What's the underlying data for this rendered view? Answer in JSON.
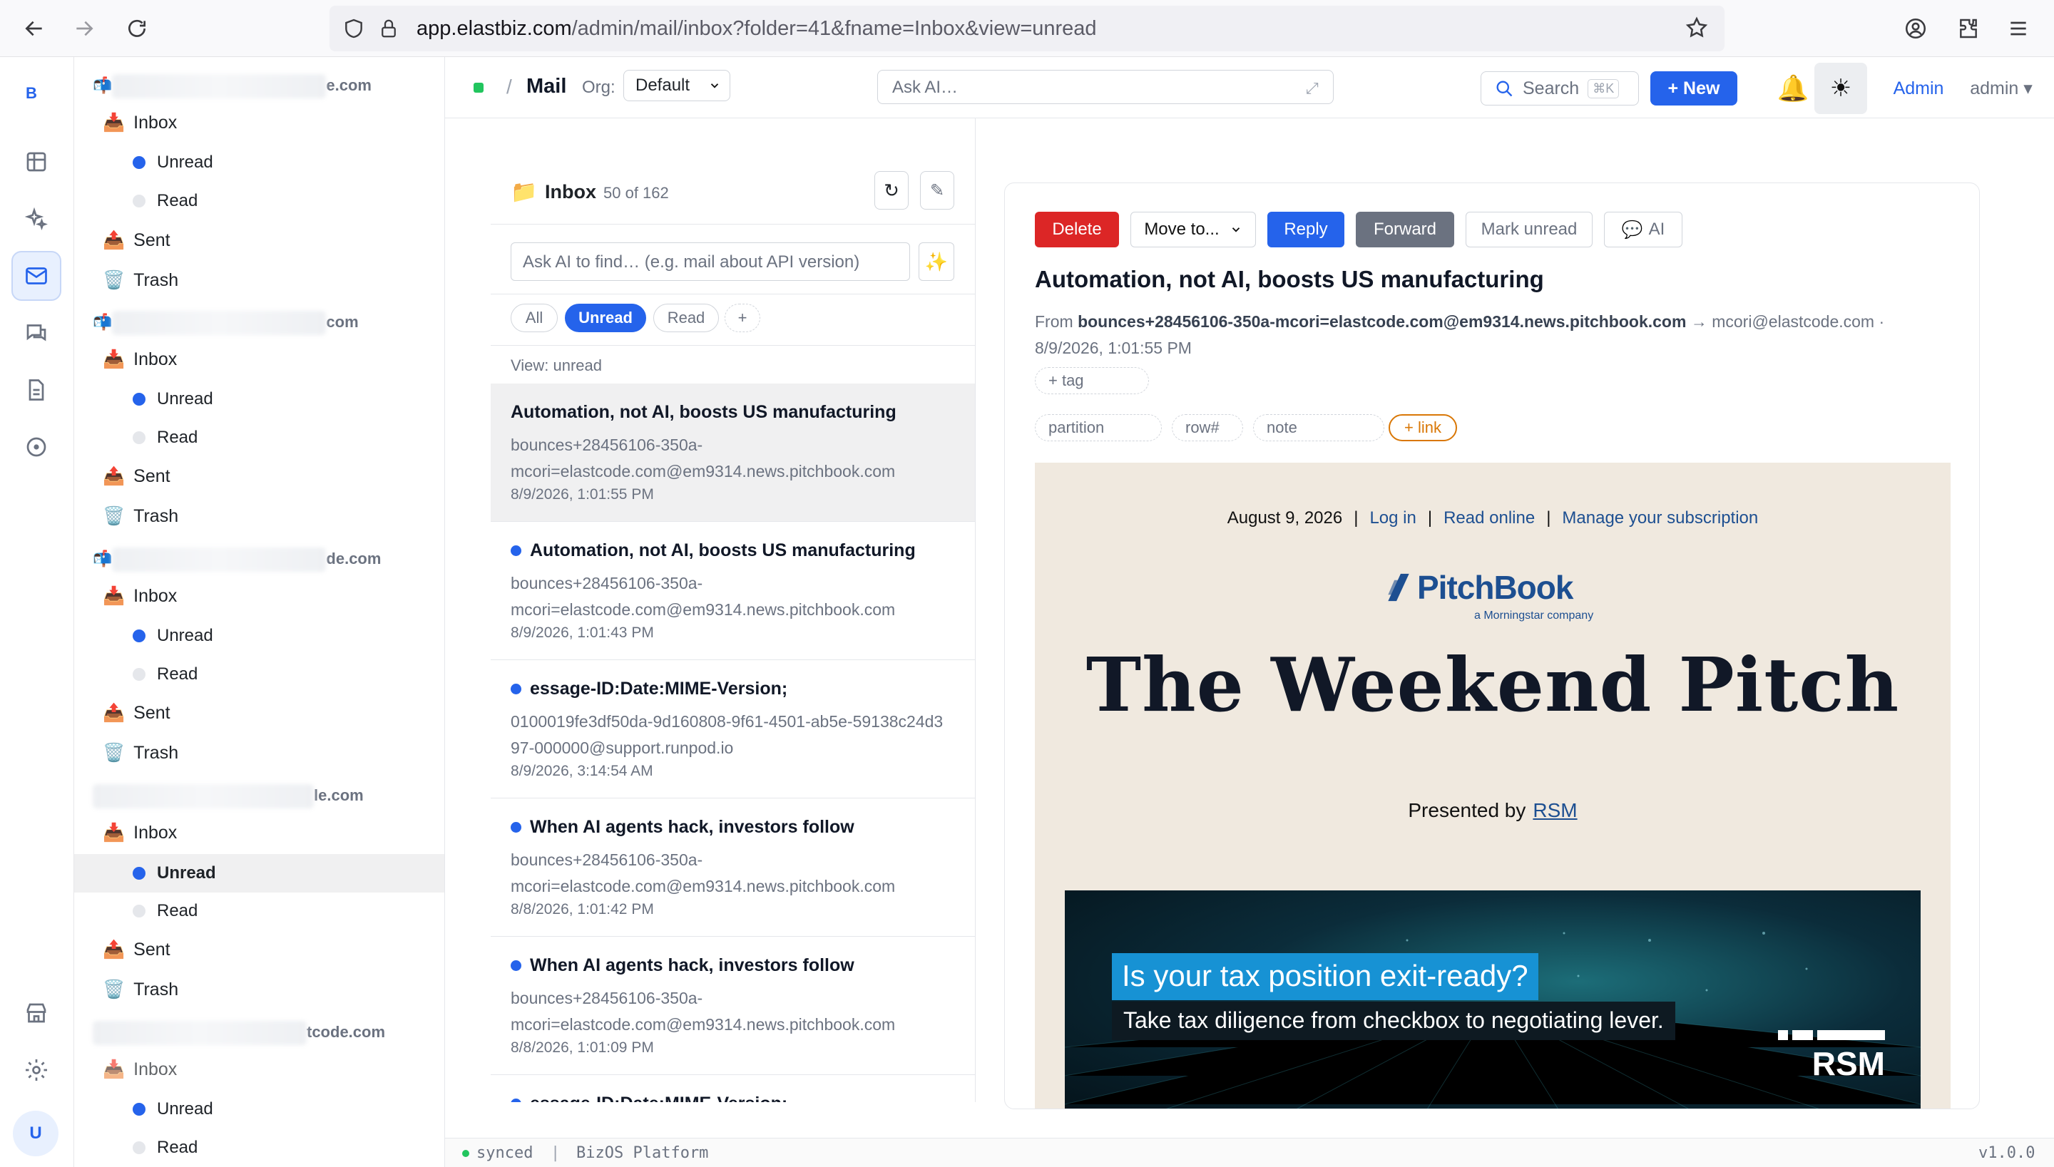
{
  "browser": {
    "url_host": "app.elastbiz.com",
    "url_path": "/admin/mail/inbox?folder=41&fname=Inbox&view=unread"
  },
  "rail": {
    "brand": "B",
    "user_initial": "U"
  },
  "accounts": [
    {
      "domain_suffix": "e.com",
      "folders": {
        "inbox": "Inbox",
        "unread": "Unread",
        "read": "Read",
        "sent": "Sent",
        "trash": "Trash"
      }
    },
    {
      "domain_suffix": "com",
      "folders": {
        "inbox": "Inbox",
        "unread": "Unread",
        "read": "Read",
        "sent": "Sent",
        "trash": "Trash"
      }
    },
    {
      "domain_suffix": "de.com",
      "folders": {
        "inbox": "Inbox",
        "unread": "Unread",
        "read": "Read",
        "sent": "Sent",
        "trash": "Trash"
      }
    },
    {
      "domain_suffix": "le.com",
      "folders": {
        "inbox": "Inbox",
        "unread": "Unread",
        "read": "Read",
        "sent": "Sent",
        "trash": "Trash"
      }
    },
    {
      "domain_suffix": "tcode.com",
      "folders": {
        "inbox": "Inbox",
        "unread": "Unread",
        "read": "Read"
      }
    }
  ],
  "header": {
    "separator": "/",
    "section": "Mail",
    "org_label": "Org:",
    "org_value": "Default",
    "ask_ai_placeholder": "Ask AI…",
    "search_label": "Search",
    "search_shortcut": "⌘K",
    "new_button": "+ New",
    "admin_link": "Admin",
    "user_menu": "admin ▾"
  },
  "list": {
    "folder_name": "Inbox",
    "count": "50 of 162",
    "ai_find_placeholder": "Ask AI to find… (e.g. mail about API version)",
    "filters": [
      "All",
      "Unread",
      "Read",
      "+"
    ],
    "active_filter": "Unread",
    "view_label": "View: unread",
    "messages": [
      {
        "subject": "Automation, not AI, boosts US manufacturing",
        "from": "bounces+28456106-350a-mcori=elastcode.com@em9314.news.pitchbook.com",
        "date": "8/9/2026, 1:01:55 PM",
        "unread": false
      },
      {
        "subject": "Automation, not AI, boosts US manufacturing",
        "from": "bounces+28456106-350a-mcori=elastcode.com@em9314.news.pitchbook.com",
        "date": "8/9/2026, 1:01:43 PM",
        "unread": true
      },
      {
        "subject": "essage-ID:Date:MIME-Version;",
        "from": "0100019fe3df50da-9d160808-9f61-4501-ab5e-59138c24d397-000000@support.runpod.io",
        "date": "8/9/2026, 3:14:54 AM",
        "unread": true
      },
      {
        "subject": "When AI agents hack, investors follow",
        "from": "bounces+28456106-350a-mcori=elastcode.com@em9314.news.pitchbook.com",
        "date": "8/8/2026, 1:01:42 PM",
        "unread": true
      },
      {
        "subject": "When AI agents hack, investors follow",
        "from": "bounces+28456106-350a-mcori=elastcode.com@em9314.news.pitchbook.com",
        "date": "8/8/2026, 1:01:09 PM",
        "unread": true
      },
      {
        "subject": "essage-ID:Date:MIME-Version;",
        "from": "",
        "date": "",
        "unread": true
      }
    ]
  },
  "reader": {
    "actions": {
      "delete": "Delete",
      "move": "Move to...",
      "reply": "Reply",
      "forward": "Forward",
      "mark_unread": "Mark unread",
      "ai": "AI"
    },
    "subject": "Automation, not AI, boosts US manufacturing",
    "from_label": "From",
    "from_address": "bounces+28456106-350a-mcori=elastcode.com@em9314.news.pitchbook.com",
    "arrow": "→",
    "to_address": "mcori@elastcode.com ·",
    "date": "8/9/2026, 1:01:55 PM",
    "tag_placeholder": "+ tag",
    "fields": {
      "partition": "partition",
      "row": "row#",
      "note": "note",
      "link": "+ link"
    }
  },
  "email": {
    "date": "August 9, 2026",
    "sep": "|",
    "login": "Log in",
    "read_online": "Read online",
    "manage": "Manage your subscription",
    "brand": "PitchBook",
    "brand_sub": "a Morningstar company",
    "headline": "The Weekend Pitch",
    "presented_by": "Presented by",
    "sponsor": "RSM",
    "ad_title": "Is your tax position exit-ready?",
    "ad_sub": "Take tax diligence from checkbox to negotiating lever.",
    "ad_logo": "RSM"
  },
  "footer": {
    "status": "synced",
    "sep": "|",
    "platform": "BizOS Platform",
    "version": "v1.0.0"
  },
  "colors": {
    "accent": "#2563eb",
    "danger": "#dc2626",
    "forward": "#6b7280",
    "email_bg": "#f0e9df",
    "link_orange": "#d97706"
  }
}
